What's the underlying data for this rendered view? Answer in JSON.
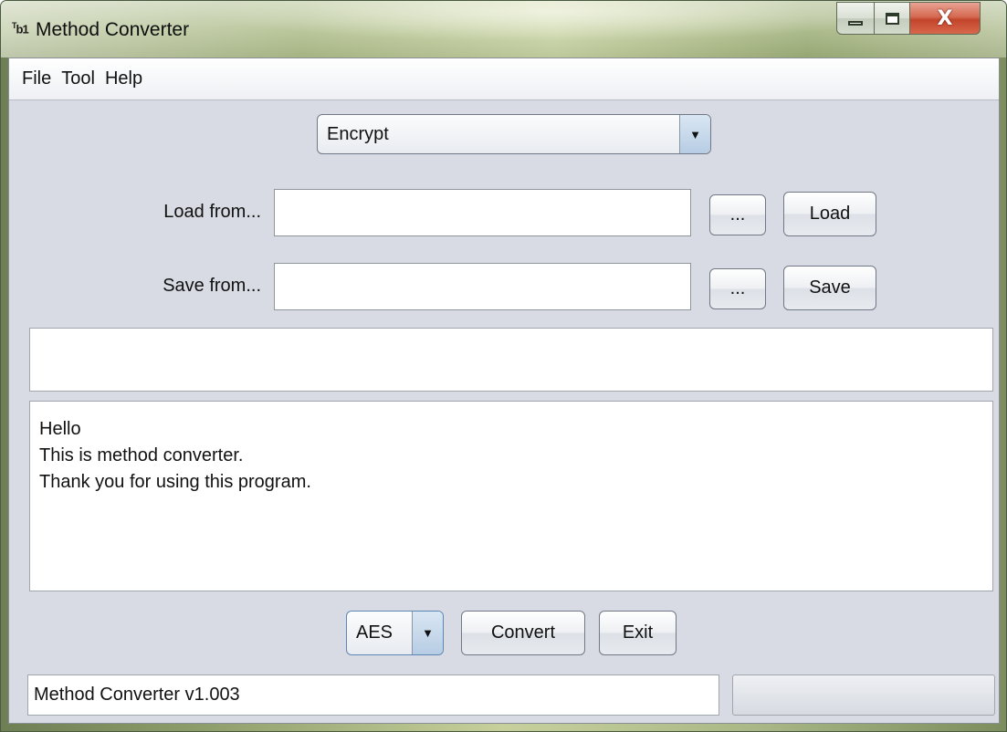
{
  "window": {
    "title": "Method Converter",
    "icon_glyph_sup": "T",
    "icon_glyph": "b1"
  },
  "menu": {
    "items": [
      "File",
      "Tool",
      "Help"
    ]
  },
  "mode_select": {
    "value": "Encrypt"
  },
  "load": {
    "label": "Load from...",
    "path_value": "",
    "browse_label": "...",
    "action_label": "Load"
  },
  "save": {
    "label": "Save from...",
    "path_value": "",
    "browse_label": "...",
    "action_label": "Save"
  },
  "input_panel": {
    "value": ""
  },
  "log": {
    "lines": [
      "Hello",
      "This is method converter.",
      "Thank you for using this program."
    ]
  },
  "controls": {
    "algorithm_value": "AES",
    "convert_label": "Convert",
    "exit_label": "Exit"
  },
  "status": {
    "text": "Method Converter v1.003"
  },
  "icons": {
    "dropdown_arrow": "▼",
    "close": "X"
  },
  "colors": {
    "client_bg": "#d8dbe3",
    "close_button": "#c3452b"
  }
}
